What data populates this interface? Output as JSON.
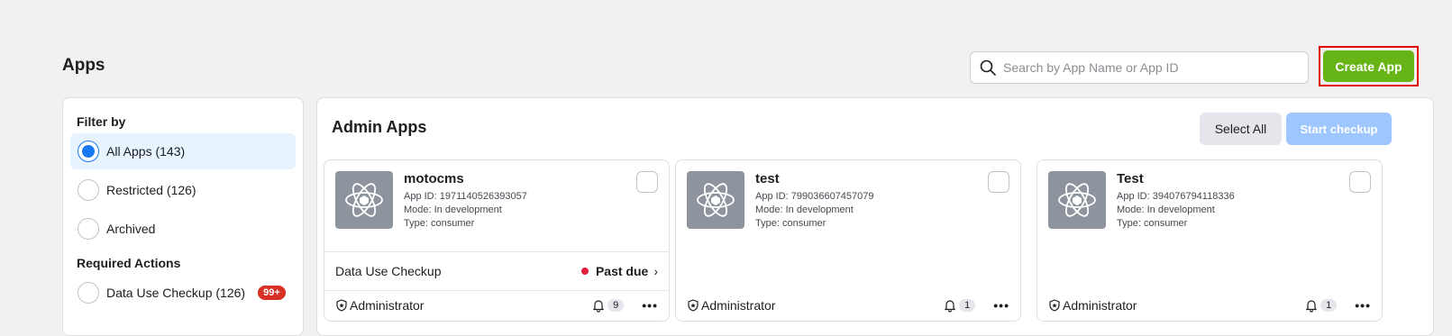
{
  "page": {
    "title": "Apps"
  },
  "search": {
    "placeholder": "Search by App Name or App ID",
    "icon": "search-icon"
  },
  "create_button": {
    "label": "Create App",
    "color": "#67b416"
  },
  "filter": {
    "heading": "Filter by",
    "options": [
      {
        "label": "All Apps (143)",
        "selected": true
      },
      {
        "label": "Restricted (126)",
        "selected": false
      },
      {
        "label": "Archived",
        "selected": false
      }
    ],
    "required_heading": "Required Actions",
    "required_options": [
      {
        "label": "Data Use Checkup (126)",
        "badge": "99+"
      }
    ]
  },
  "main": {
    "title": "Admin Apps",
    "select_all_label": "Select All",
    "start_checkup_label": "Start checkup",
    "apps": [
      {
        "name": "motocms",
        "app_id": "App ID: 1971140526393057",
        "mode": "Mode: In development",
        "type": "Type: consumer",
        "checkup_label": "Data Use Checkup",
        "checkup_status": "Past due",
        "role": "Administrator",
        "notifications": "9",
        "more": "•••"
      },
      {
        "name": "test",
        "app_id": "App ID: 799036607457079",
        "mode": "Mode: In development",
        "type": "Type: consumer",
        "role": "Administrator",
        "notifications": "1",
        "more": "•••"
      },
      {
        "name": "Test",
        "app_id": "App ID: 394076794118336",
        "mode": "Mode: In development",
        "type": "Type: consumer",
        "role": "Administrator",
        "notifications": "1",
        "more": "•••"
      }
    ]
  }
}
